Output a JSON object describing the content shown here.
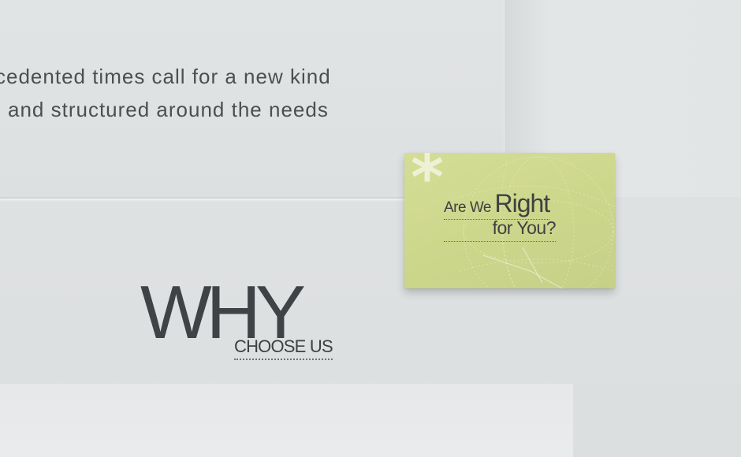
{
  "intro": {
    "line1": "cedented times call for a new kind",
    "line2": "and structured around the needs"
  },
  "sticky_note": {
    "icon": "asterisk-icon",
    "line1_small": "Are We",
    "line1_big": "Right",
    "line2": "for You?",
    "color": "#cfd88f"
  },
  "why_section": {
    "heading": "WHY",
    "link": "CHOOSE US"
  }
}
